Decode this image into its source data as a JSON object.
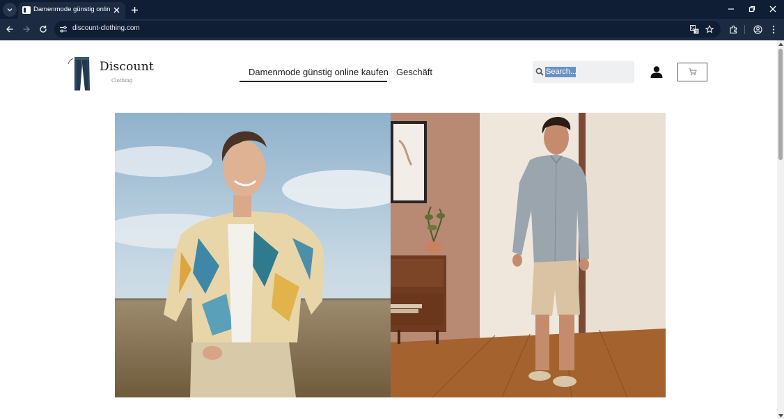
{
  "browser": {
    "tab_title": "Damenmode günstig online kaufen",
    "url": "discount-clothing.com"
  },
  "site": {
    "logo_name": "Discount",
    "logo_sub": "Clothing",
    "nav": [
      {
        "label": "Damenmode günstig online kaufen",
        "active": true
      },
      {
        "label": "Geschäft",
        "active": false
      }
    ],
    "search_placeholder": "Search...",
    "search_value": "Search..."
  },
  "colors": {
    "titlebar": "#0f1d35",
    "toolbar": "#1c2a42",
    "selection": "#6a92c7"
  },
  "icons": [
    "tab-list-icon",
    "favicon-icon",
    "close-icon",
    "plus-icon",
    "minimize-icon",
    "restore-icon",
    "back-icon",
    "forward-icon",
    "reload-icon",
    "site-info-icon",
    "translate-icon",
    "star-icon",
    "extensions-icon",
    "profile-icon",
    "menu-icon",
    "search-icon",
    "user-icon",
    "cart-icon"
  ]
}
